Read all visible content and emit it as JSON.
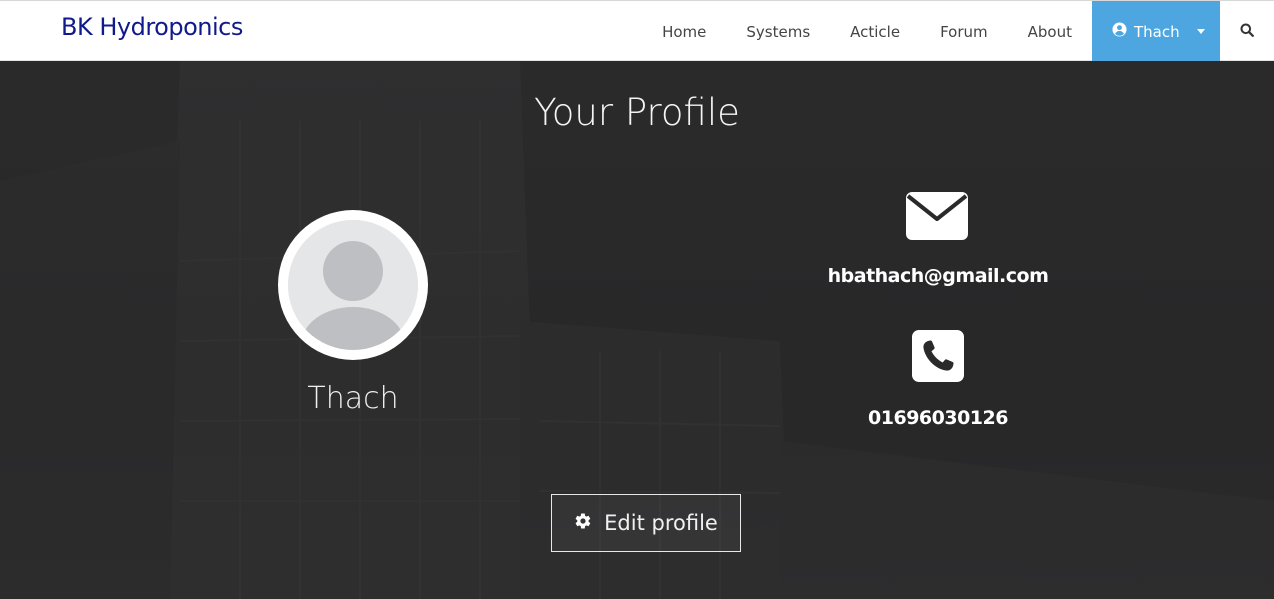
{
  "nav": {
    "brand": "BK Hydroponics",
    "links": [
      "Home",
      "Systems",
      "Acticle",
      "Forum",
      "About"
    ],
    "user_label": "Thach",
    "user_icon": "user-circle-icon",
    "search_icon": "search-icon",
    "active_color": "#4ea6e0",
    "brand_color": "#101a8a"
  },
  "profile": {
    "title": "Your Profile",
    "name": "Thach",
    "avatar_icon": "default-avatar-icon",
    "email": "hbathach@gmail.com",
    "email_icon": "envelope-icon",
    "phone": "01696030126",
    "phone_icon": "phone-icon",
    "edit_label": "Edit profile",
    "edit_icon": "gear-icon"
  }
}
